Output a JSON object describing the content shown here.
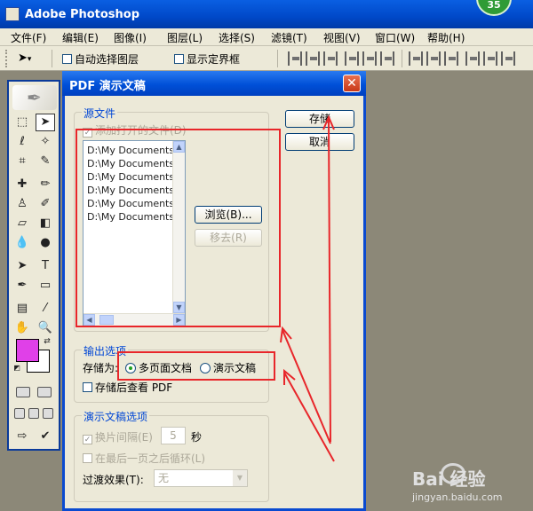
{
  "app": {
    "title": "Adobe Photoshop",
    "badge_count": "35"
  },
  "menu": {
    "items": [
      "文件(F)",
      "编辑(E)",
      "图像(I)",
      "图层(L)",
      "选择(S)",
      "滤镜(T)",
      "视图(V)",
      "窗口(W)",
      "帮助(H)"
    ]
  },
  "options_bar": {
    "auto_select_layer": "自动选择图层",
    "show_bounding_box": "显示定界框"
  },
  "dialog": {
    "title": "PDF 演示文稿",
    "close_glyph": "✕",
    "source": {
      "group_title": "源文件",
      "add_open_files": "添加打开的文件(D)",
      "files": [
        "D:\\My Documents",
        "D:\\My Documents",
        "D:\\My Documents",
        "D:\\My Documents",
        "D:\\My Documents",
        "D:\\My Documents"
      ],
      "browse_label": "浏览(B)...",
      "remove_label": "移去(R)"
    },
    "buttons": {
      "save": "存储",
      "cancel": "取消"
    },
    "output": {
      "group_title": "输出选项",
      "save_as_label": "存储为:",
      "multi_page": "多页面文档",
      "presentation": "演示文稿",
      "selected": "multi_page",
      "view_after_save": "存储后查看 PDF"
    },
    "presentation_options": {
      "group_title": "演示文稿选项",
      "advance_every": "换片间隔(E)",
      "advance_value": "5",
      "seconds": "秒",
      "loop_after_last": "在最后一页之后循环(L)",
      "transition_label": "过渡效果(T):",
      "transition_value": "无"
    }
  },
  "watermark": {
    "logo": "Bai 经验",
    "url": "jingyan.baidu.com"
  },
  "colors": {
    "foreground": "#e040e8",
    "background": "#ffffff",
    "highlight_red": "#e8262a",
    "title_blue": "#0a4ad0"
  }
}
